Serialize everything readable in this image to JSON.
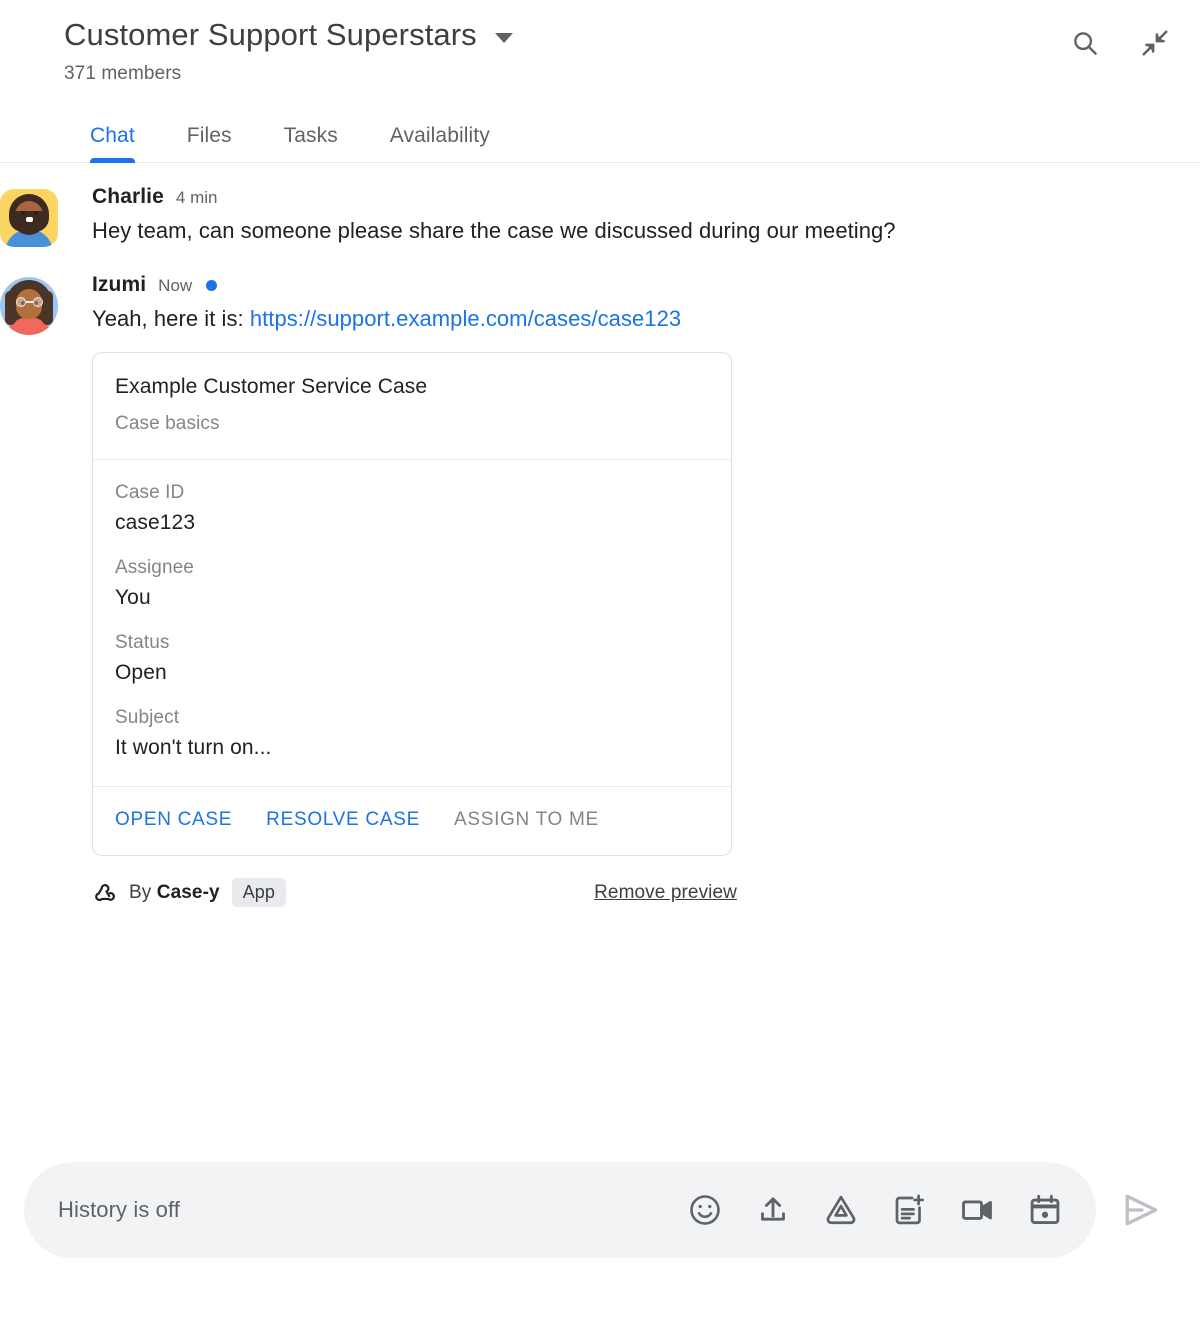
{
  "header": {
    "room_title": "Customer Support Superstars",
    "members": "371 members",
    "dropdown_icon": "chevron-down-icon",
    "search_icon": "search-icon",
    "collapse_icon": "collapse-icon"
  },
  "tabs": [
    {
      "label": "Chat",
      "active": true
    },
    {
      "label": "Files",
      "active": false
    },
    {
      "label": "Tasks",
      "active": false
    },
    {
      "label": "Availability",
      "active": false
    }
  ],
  "messages": [
    {
      "author": "Charlie",
      "time": "4 min",
      "unread": false,
      "text": "Hey team, can someone please share the case we discussed during our meeting?"
    },
    {
      "author": "Izumi",
      "time": "Now",
      "unread": true,
      "text_prefix": "Yeah, here it is: ",
      "link_text": "https://support.example.com/cases/case123"
    }
  ],
  "card": {
    "title": "Example Customer Service Case",
    "subtitle": "Case basics",
    "fields": [
      {
        "label": "Case ID",
        "value": "case123"
      },
      {
        "label": "Assignee",
        "value": "You"
      },
      {
        "label": "Status",
        "value": "Open"
      },
      {
        "label": "Subject",
        "value": "It won't turn on..."
      }
    ],
    "actions": [
      {
        "label": "OPEN CASE",
        "enabled": true
      },
      {
        "label": "RESOLVE CASE",
        "enabled": true
      },
      {
        "label": "ASSIGN TO ME",
        "enabled": false
      }
    ],
    "attribution": {
      "icon": "webhook-icon",
      "by_prefix": "By ",
      "app_name": "Case-y",
      "chip": "App",
      "remove_label": "Remove preview"
    }
  },
  "composer": {
    "placeholder": "History is off",
    "icons": [
      "emoji-icon",
      "upload-icon",
      "google-drive-icon",
      "add-document-icon",
      "video-meeting-icon",
      "calendar-icon"
    ],
    "send_icon": "send-icon"
  },
  "colors": {
    "accent": "#1a73e8",
    "text_primary": "#202124",
    "text_secondary": "#5f6368",
    "text_muted": "#80868b",
    "border": "#e0e0e0",
    "composer_bg": "#f1f3f4",
    "chip_bg": "#e8eaed",
    "send_disabled": "#bdc1c6"
  }
}
